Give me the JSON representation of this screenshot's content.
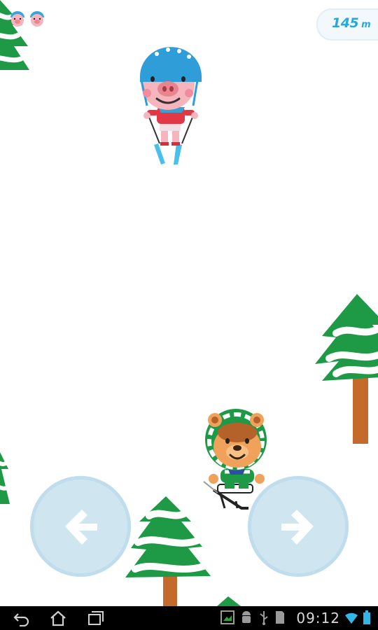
{
  "hud": {
    "lives_count": 2,
    "distance_value": "145",
    "distance_unit": "m"
  },
  "controls": {
    "left_icon": "arrow-left-icon",
    "right_icon": "arrow-right-icon"
  },
  "status_bar": {
    "time": "09:12",
    "nav_icons": [
      "back-icon",
      "home-icon",
      "recent-apps-icon"
    ],
    "notification_icons": [
      "gallery-icon",
      "android-debug-icon",
      "usb-icon",
      "sd-card-icon"
    ],
    "status_icons": [
      "wifi-icon",
      "battery-icon"
    ]
  },
  "colors": {
    "accent_blue": "#2aa7d8",
    "tree_green": "#1e9a46",
    "trunk_brown": "#c46a2c",
    "control_blue": "#cfe6f1"
  }
}
